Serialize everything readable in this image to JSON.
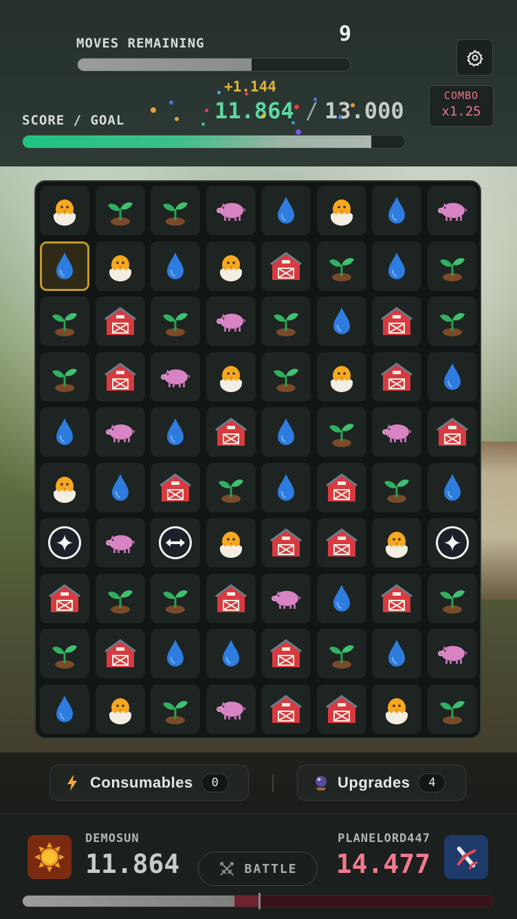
{
  "header": {
    "moves_label": "MOVES REMAINING",
    "moves_value": "9",
    "moves_progress": 0.64,
    "score_label": "SCORE / GOAL",
    "score_gain": "+1.144",
    "score_current": "11.864",
    "score_separator": "/",
    "score_goal": "13.000",
    "score_progress": 0.9126,
    "combo_label": "COMBO",
    "combo_value": "x1.25",
    "settings_icon": "gear-icon"
  },
  "board": {
    "rows": 10,
    "cols": 8,
    "selected": [
      1,
      0
    ],
    "tiles": [
      [
        "chick",
        "sprout",
        "sprout",
        "pig",
        "drop",
        "chick",
        "drop",
        "pig"
      ],
      [
        "drop",
        "chick",
        "drop",
        "chick",
        "barn",
        "sprout",
        "drop",
        "sprout"
      ],
      [
        "sprout",
        "barn",
        "sprout",
        "pig",
        "sprout",
        "drop",
        "barn",
        "sprout"
      ],
      [
        "sprout",
        "barn",
        "pig",
        "chick",
        "sprout",
        "chick",
        "barn",
        "drop"
      ],
      [
        "drop",
        "pig",
        "drop",
        "barn",
        "drop",
        "sprout",
        "pig",
        "barn"
      ],
      [
        "chick",
        "drop",
        "barn",
        "sprout",
        "drop",
        "barn",
        "sprout",
        "drop"
      ],
      [
        "sparkle",
        "pig",
        "swap",
        "chick",
        "barn",
        "barn",
        "chick",
        "sparkle"
      ],
      [
        "barn",
        "sprout",
        "sprout",
        "barn",
        "pig",
        "drop",
        "barn",
        "sprout"
      ],
      [
        "sprout",
        "barn",
        "drop",
        "drop",
        "barn",
        "sprout",
        "drop",
        "pig"
      ],
      [
        "drop",
        "chick",
        "sprout",
        "pig",
        "barn",
        "barn",
        "chick",
        "sprout"
      ]
    ],
    "tile_icons": {
      "chick": "hatching-chick-icon",
      "sprout": "seedling-icon",
      "pig": "pig-icon",
      "drop": "water-drop-icon",
      "barn": "barn-icon",
      "sparkle": "sparkle-bomb-icon",
      "swap": "horizontal-swap-icon"
    }
  },
  "toolbar": {
    "consumables_label": "Consumables",
    "consumables_count": "0",
    "consumables_icon": "lightning-icon",
    "upgrades_label": "Upgrades",
    "upgrades_count": "4",
    "upgrades_icon": "crystal-ball-icon"
  },
  "versus": {
    "player_name": "DEMOSUN",
    "player_score": "11.864",
    "player_avatar": "sun-icon",
    "battle_label": "BATTLE",
    "battle_icon": "crossed-swords-icon",
    "opponent_name": "PLANELORD447",
    "opponent_score": "14.477",
    "opponent_avatar": "airplane-icon",
    "player_share": 0.45,
    "colors": {
      "player": "#c6cbc8",
      "opponent": "#f07a8e",
      "accent_green": "#1ec47f",
      "combo": "#e57a8e",
      "selected_border": "#c49a2a"
    }
  }
}
